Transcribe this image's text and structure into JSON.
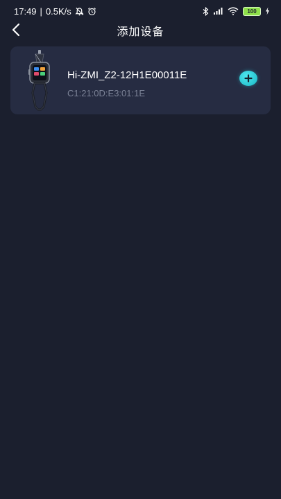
{
  "status_bar": {
    "time": "17:49",
    "separator": "|",
    "network_speed": "0.5K/s",
    "battery_level": "100",
    "icons_left": [
      "mute-bell-icon",
      "alarm-icon"
    ],
    "icons_right": [
      "bluetooth-icon",
      "signal-icon",
      "wifi-icon",
      "battery-icon",
      "charging-icon"
    ]
  },
  "header": {
    "title": "添加设备",
    "back_icon": "chevron-left-icon"
  },
  "device_list": [
    {
      "name": "Hi-ZMI_Z2-12H1E00011E",
      "mac": "C1:21:0D:E3:01:1E",
      "action_icon": "plus-icon"
    }
  ],
  "colors": {
    "background": "#1b1f2e",
    "card": "#262c42",
    "accent": "#26c6d4",
    "secondary_text": "#7b8296",
    "battery": "#8ee04a"
  }
}
